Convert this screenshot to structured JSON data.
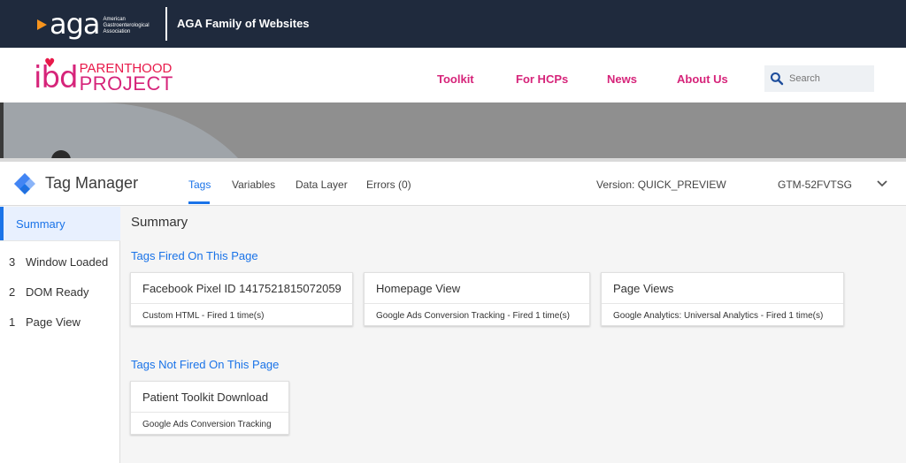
{
  "aga": {
    "logo_word": "aga",
    "logo_sub": "American Gastroenterological Association",
    "family_link": "AGA Family of Websites"
  },
  "site": {
    "logo_mark": "ibd",
    "logo_top": "PARENTHOOD",
    "logo_bottom": "PROJECT",
    "nav": [
      "Toolkit",
      "For HCPs",
      "News",
      "About Us"
    ],
    "search_placeholder": "Search",
    "brand_color": "#d6247a"
  },
  "gtm": {
    "title": "Tag Manager",
    "tabs": [
      {
        "label": "Tags",
        "active": true
      },
      {
        "label": "Variables",
        "active": false
      },
      {
        "label": "Data Layer",
        "active": false
      },
      {
        "label": "Errors (0)",
        "active": false
      }
    ],
    "version": "Version: QUICK_PREVIEW",
    "container_id": "GTM-52FVTSG",
    "sidebar": {
      "summary": "Summary",
      "events": [
        {
          "num": "3",
          "label": "Window Loaded"
        },
        {
          "num": "2",
          "label": "DOM Ready"
        },
        {
          "num": "1",
          "label": "Page View"
        }
      ]
    },
    "main": {
      "title": "Summary",
      "fired_heading": "Tags Fired On This Page",
      "fired": [
        {
          "name": "Facebook Pixel ID 1417521815072059",
          "type": "Custom HTML",
          "status": " - Fired 1 time(s)"
        },
        {
          "name": "Homepage View",
          "type": "Google Ads Conversion Tracking",
          "status": " - Fired 1 time(s)"
        },
        {
          "name": "Page Views",
          "type": "Google Analytics: Universal Analytics",
          "status": " - Fired 1 time(s)"
        }
      ],
      "not_fired_heading": "Tags Not Fired On This Page",
      "not_fired": [
        {
          "name": "Patient Toolkit Download",
          "type": "Google Ads Conversion Tracking",
          "status": ""
        }
      ]
    },
    "accent_color": "#1a73e8"
  }
}
